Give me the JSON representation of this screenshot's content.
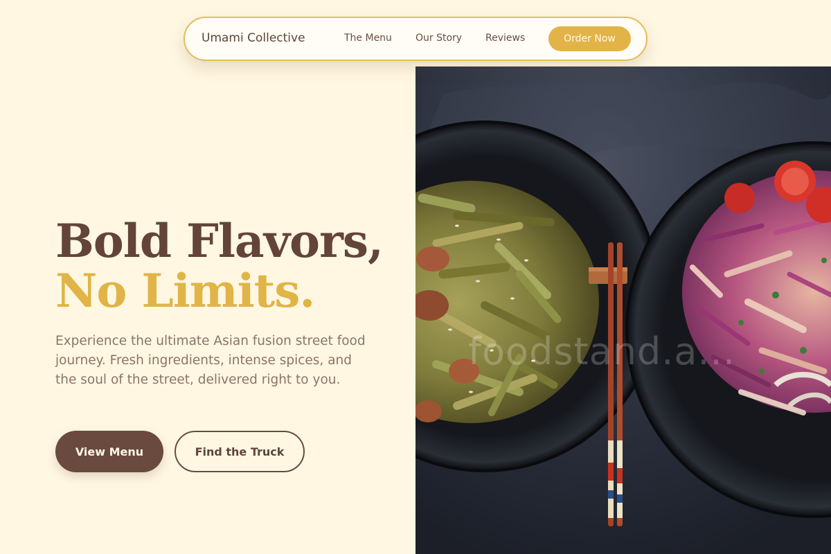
{
  "brand": "Umami Collective",
  "nav": {
    "links": [
      "The Menu",
      "Our Story",
      "Reviews"
    ],
    "cta": "Order Now"
  },
  "hero": {
    "headline_line1": "Bold Flavors,",
    "headline_line2": "No Limits.",
    "description": "Experience the ultimate Asian fusion street food journey. Fresh ingredients, intense spices, and the soul of the street, delivered right to you.",
    "primary_button": "View Menu",
    "secondary_button": "Find the Truck"
  },
  "image": {
    "watermark": "foodstand.a..."
  },
  "colors": {
    "background": "#FFF7E2",
    "brown": "#634438",
    "gold": "#E0B446",
    "muted_text": "#8C7466"
  }
}
